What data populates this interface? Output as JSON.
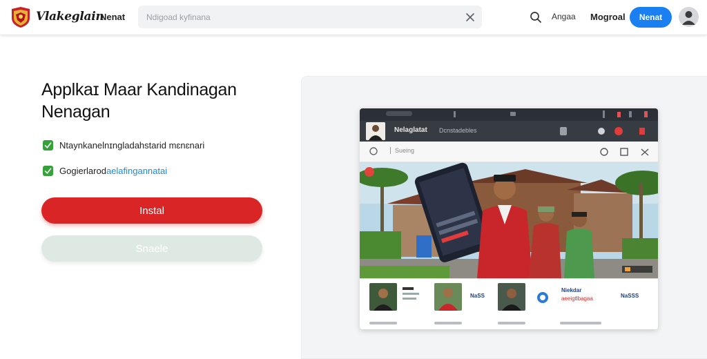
{
  "header": {
    "brand": "Vlakeglain",
    "nav_home": "Nenat",
    "search_placeholder": "Ndigoad kyfinana",
    "nav_item_a": "Angaa",
    "nav_item_b": "Mogroal",
    "cta_label": "Nenat"
  },
  "hero": {
    "title_line1": "Applkaɪ Maar Kandinagan",
    "title_line2": "Nenagan",
    "features": [
      {
        "text": "Ntaynkanelnɪngladahstarid mɛnɛnari",
        "link": ""
      },
      {
        "text": "Gogierlarod ",
        "link": "aelafingannatai"
      }
    ],
    "install_label": "Instal",
    "share_label": "Snaele"
  },
  "device": {
    "app_title": "Nelaglatat",
    "app_subtitle": "Dcnstadebles",
    "toolbar_search": "Sueing",
    "strip": {
      "label_a": "NaSS",
      "label_b": "Niekdar",
      "label_b_red": "aeeigtlbagaa",
      "label_c": "NaSSS"
    }
  },
  "colors": {
    "primary_red": "#d92525",
    "accent_blue": "#1a7ff0",
    "check_green": "#36a03a"
  },
  "icons": [
    "garuda-logo",
    "close-icon",
    "search-icon",
    "user-avatar-icon",
    "check-icon"
  ]
}
